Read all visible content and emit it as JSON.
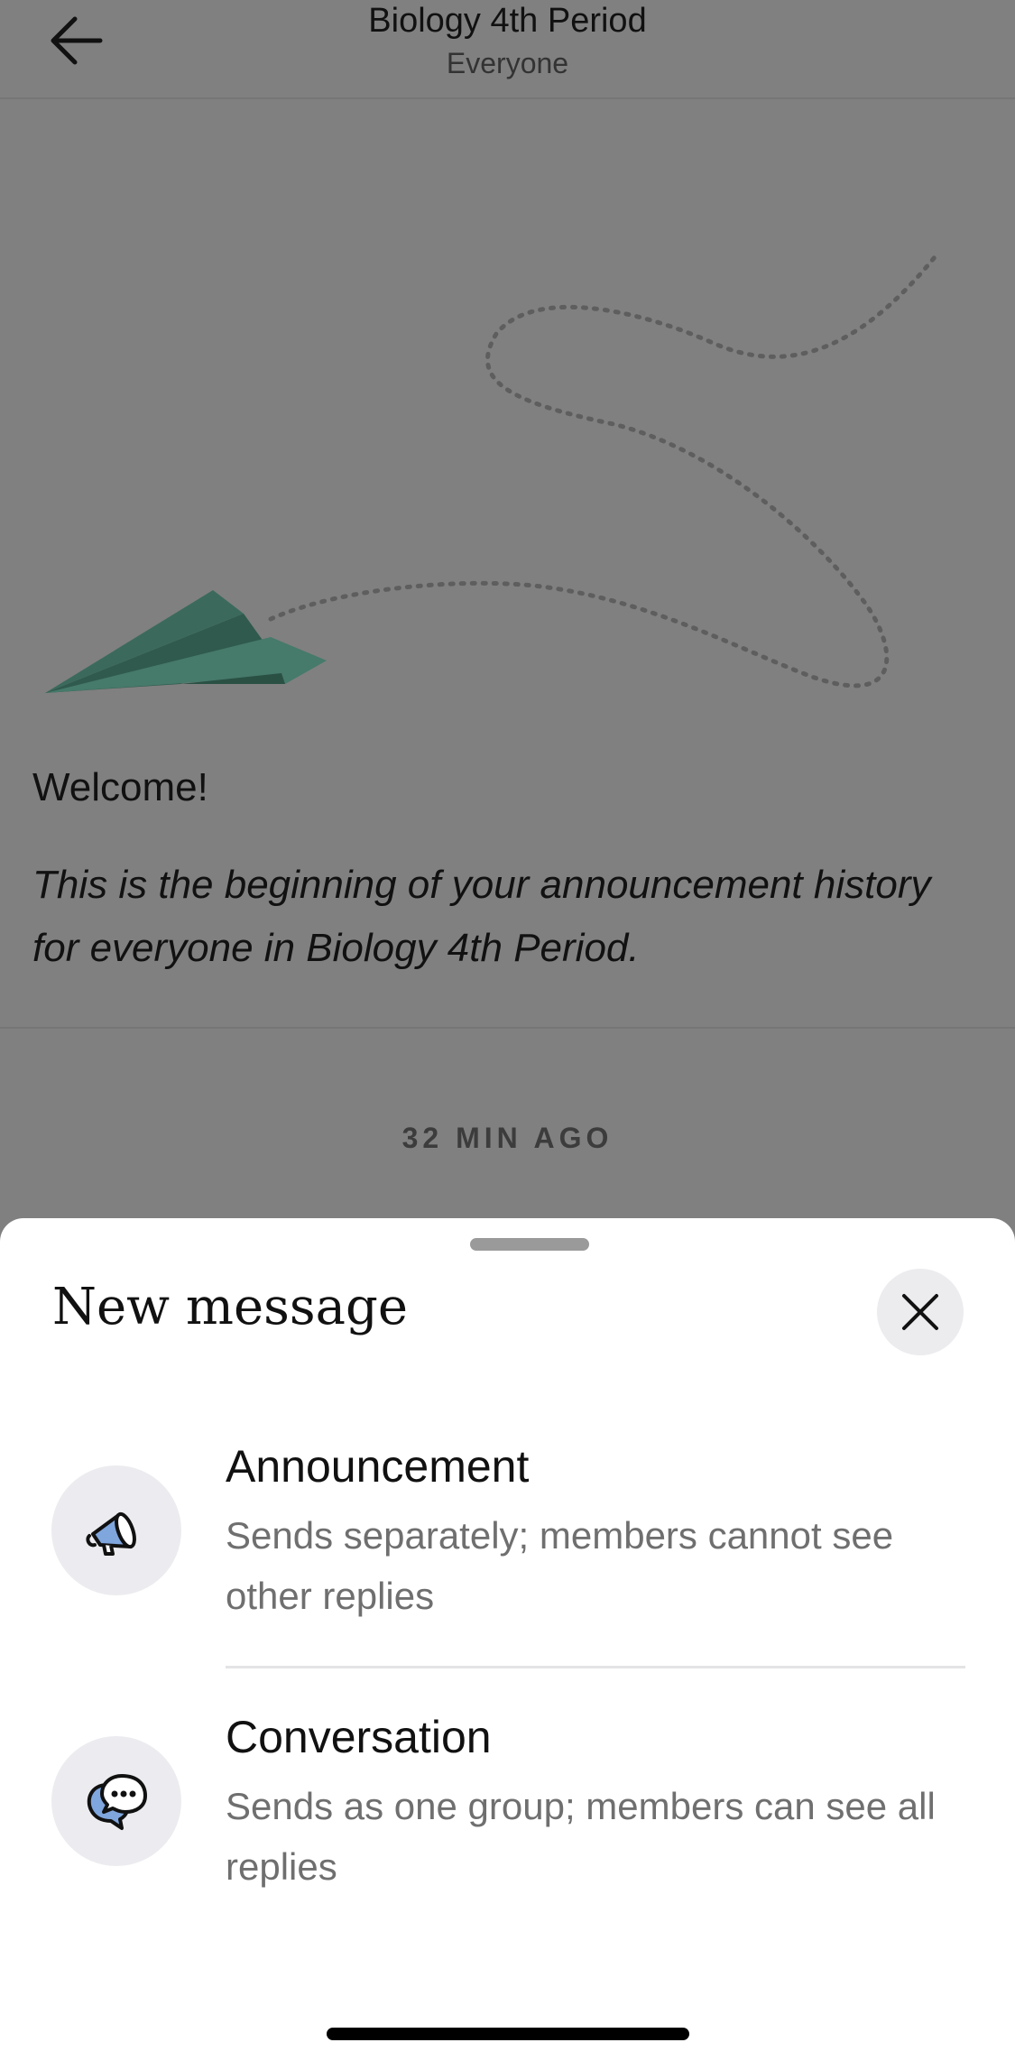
{
  "header": {
    "title": "Biology 4th Period",
    "subtitle": "Everyone",
    "back_icon": "arrow-left-icon"
  },
  "intro": {
    "welcome": "Welcome!",
    "text": "This is the beginning of your announcement history for everyone in Biology 4th Period.",
    "illustration_icon": "paper-plane-icon"
  },
  "timestamp": "32 MIN AGO",
  "sheet": {
    "title": "New message",
    "close_icon": "close-icon",
    "options": [
      {
        "title": "Announcement",
        "description": "Sends separately; members cannot see other replies",
        "icon": "megaphone-icon"
      },
      {
        "title": "Conversation",
        "description": "Sends as one group; members can see all replies",
        "icon": "chat-bubbles-icon"
      }
    ]
  },
  "colors": {
    "overlay_background": "#808080",
    "sheet_background": "#ffffff",
    "icon_circle": "#ececf0",
    "plane_green": "#3d6b5e",
    "icon_accent_blue": "#7fa6dd"
  }
}
